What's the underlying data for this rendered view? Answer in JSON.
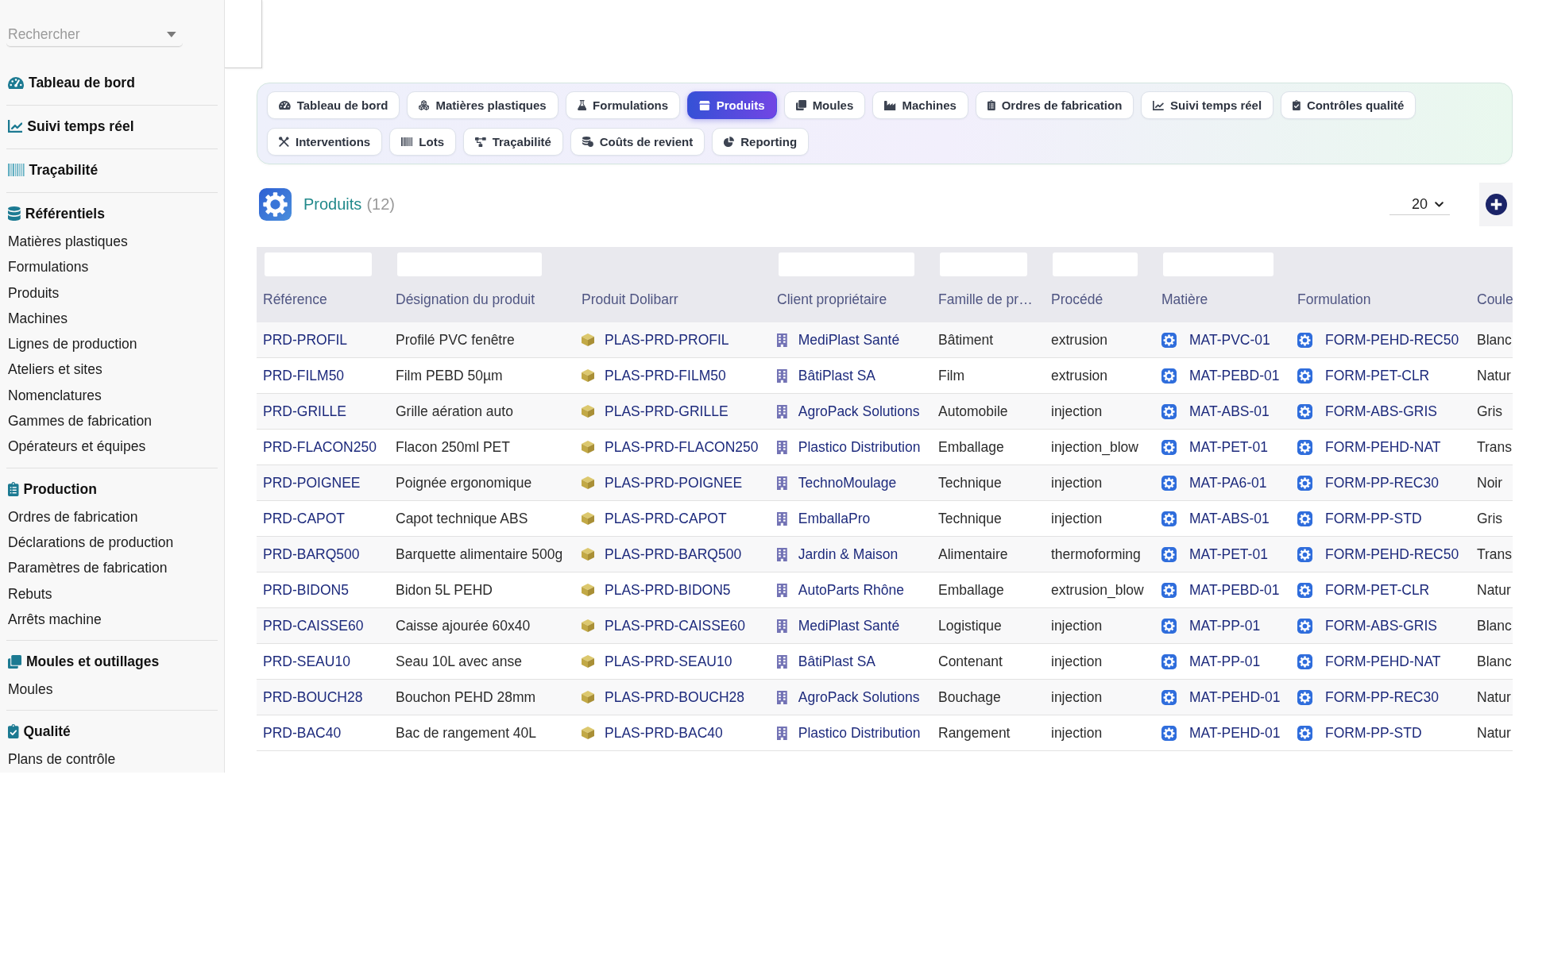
{
  "sidebar": {
    "search": {
      "placeholder": "Rechercher"
    },
    "sections": [
      {
        "title": "Tableau de bord"
      },
      {
        "title": "Suivi temps réel"
      },
      {
        "title": "Traçabilité"
      },
      {
        "title": "Référentiels",
        "items": [
          "Matières plastiques",
          "Formulations",
          "Produits",
          "Machines",
          "Lignes de production",
          "Ateliers et sites",
          "Nomenclatures",
          "Gammes de fabrication",
          "Opérateurs et équipes"
        ]
      },
      {
        "title": "Production",
        "items": [
          "Ordres de fabrication",
          "Déclarations de production",
          "Paramètres de fabrication",
          "Rebuts",
          "Arrêts machine"
        ]
      },
      {
        "title": "Moules et outillages",
        "items": [
          "Moules"
        ]
      },
      {
        "title": "Qualité",
        "items": [
          "Plans de contrôle"
        ]
      }
    ]
  },
  "tabs": [
    {
      "label": "Tableau de bord",
      "selected": false
    },
    {
      "label": "Matières plastiques",
      "selected": false
    },
    {
      "label": "Formulations",
      "selected": false
    },
    {
      "label": "Produits",
      "selected": true
    },
    {
      "label": "Moules",
      "selected": false
    },
    {
      "label": "Machines",
      "selected": false
    },
    {
      "label": "Ordres de fabrication",
      "selected": false
    },
    {
      "label": "Suivi temps réel",
      "selected": false
    },
    {
      "label": "Contrôles qualité",
      "selected": false
    },
    {
      "label": "Interventions",
      "selected": false
    },
    {
      "label": "Lots",
      "selected": false
    },
    {
      "label": "Traçabilité",
      "selected": false
    },
    {
      "label": "Coûts de revient",
      "selected": false
    },
    {
      "label": "Reporting",
      "selected": false
    }
  ],
  "list_header": {
    "title": "Produits",
    "count": "(12)",
    "page_size": "20"
  },
  "table": {
    "columns": [
      {
        "label": "Référence",
        "kind": "link",
        "filter": true
      },
      {
        "label": "Désignation du produit",
        "kind": "text",
        "filter": true
      },
      {
        "label": "Produit Dolibarr",
        "kind": "product",
        "filter": false
      },
      {
        "label": "Client propriétaire",
        "kind": "company",
        "filter": true
      },
      {
        "label": "Famille de pr…",
        "kind": "text",
        "filter": true
      },
      {
        "label": "Procédé",
        "kind": "text",
        "filter": true
      },
      {
        "label": "Matière",
        "kind": "object",
        "filter": true
      },
      {
        "label": "Formulation",
        "kind": "object",
        "filter": false
      },
      {
        "label": "Coule",
        "kind": "text",
        "filter": false
      }
    ],
    "rows": [
      [
        "PRD-PROFIL",
        "Profilé PVC fenêtre",
        "PLAS-PRD-PROFIL",
        "MediPlast Santé",
        "Bâtiment",
        "extrusion",
        "MAT-PVC-01",
        "FORM-PEHD-REC50",
        "Blanc"
      ],
      [
        "PRD-FILM50",
        "Film PEBD 50µm",
        "PLAS-PRD-FILM50",
        "BâtiPlast SA",
        "Film",
        "extrusion",
        "MAT-PEBD-01",
        "FORM-PET-CLR",
        "Natur"
      ],
      [
        "PRD-GRILLE",
        "Grille aération auto",
        "PLAS-PRD-GRILLE",
        "AgroPack Solutions",
        "Automobile",
        "injection",
        "MAT-ABS-01",
        "FORM-ABS-GRIS",
        "Gris"
      ],
      [
        "PRD-FLACON250",
        "Flacon 250ml PET",
        "PLAS-PRD-FLACON250",
        "Plastico Distribution",
        "Emballage",
        "injection_blow",
        "MAT-PET-01",
        "FORM-PEHD-NAT",
        "Trans"
      ],
      [
        "PRD-POIGNEE",
        "Poignée ergonomique",
        "PLAS-PRD-POIGNEE",
        "TechnoMoulage",
        "Technique",
        "injection",
        "MAT-PA6-01",
        "FORM-PP-REC30",
        "Noir"
      ],
      [
        "PRD-CAPOT",
        "Capot technique ABS",
        "PLAS-PRD-CAPOT",
        "EmballaPro",
        "Technique",
        "injection",
        "MAT-ABS-01",
        "FORM-PP-STD",
        "Gris"
      ],
      [
        "PRD-BARQ500",
        "Barquette alimentaire 500g",
        "PLAS-PRD-BARQ500",
        "Jardin & Maison",
        "Alimentaire",
        "thermoforming",
        "MAT-PET-01",
        "FORM-PEHD-REC50",
        "Trans"
      ],
      [
        "PRD-BIDON5",
        "Bidon 5L PEHD",
        "PLAS-PRD-BIDON5",
        "AutoParts Rhône",
        "Emballage",
        "extrusion_blow",
        "MAT-PEBD-01",
        "FORM-PET-CLR",
        "Natur"
      ],
      [
        "PRD-CAISSE60",
        "Caisse ajourée 60x40",
        "PLAS-PRD-CAISSE60",
        "MediPlast Santé",
        "Logistique",
        "injection",
        "MAT-PP-01",
        "FORM-ABS-GRIS",
        "Blanc"
      ],
      [
        "PRD-SEAU10",
        "Seau 10L avec anse",
        "PLAS-PRD-SEAU10",
        "BâtiPlast SA",
        "Contenant",
        "injection",
        "MAT-PP-01",
        "FORM-PEHD-NAT",
        "Blanc"
      ],
      [
        "PRD-BOUCH28",
        "Bouchon PEHD 28mm",
        "PLAS-PRD-BOUCH28",
        "AgroPack Solutions",
        "Bouchage",
        "injection",
        "MAT-PEHD-01",
        "FORM-PP-REC30",
        "Natur"
      ],
      [
        "PRD-BAC40",
        "Bac de rangement 40L",
        "PLAS-PRD-BAC40",
        "Plastico Distribution",
        "Rangement",
        "injection",
        "MAT-PEHD-01",
        "FORM-PP-STD",
        "Natur"
      ]
    ]
  }
}
